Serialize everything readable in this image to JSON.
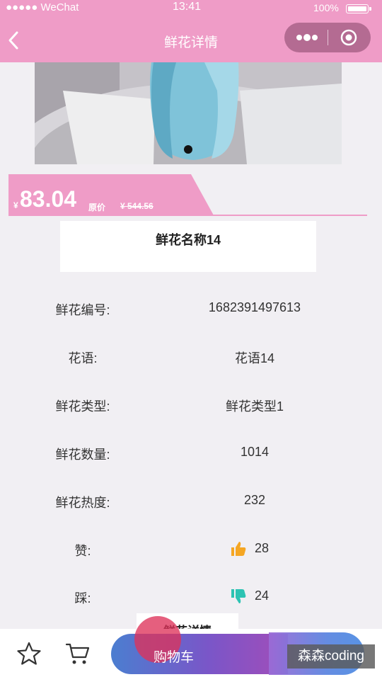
{
  "status_bar": {
    "carrier": "●●●●● WeChat",
    "time": "13:41",
    "battery": "100%"
  },
  "nav": {
    "title": "鲜花详情",
    "back_icon": "chevron-left-icon",
    "more_icon": "more-dots-icon",
    "close_icon": "target-circle-icon"
  },
  "price": {
    "currency": "¥",
    "current": "83.04",
    "original_label": "原价",
    "original_value": "¥ 544.56"
  },
  "flower": {
    "name": "鲜花名称14"
  },
  "details": [
    {
      "label": "鲜花编号:",
      "value": "1682391497613"
    },
    {
      "label": "花语:",
      "value": "花语14"
    },
    {
      "label": "鲜花类型:",
      "value": "鲜花类型1"
    },
    {
      "label": "鲜花数量:",
      "value": "1014"
    },
    {
      "label": "鲜花热度:",
      "value": "232"
    }
  ],
  "votes": {
    "like_label": "赞:",
    "like_count": "28",
    "dislike_label": "踩:",
    "dislike_count": "24"
  },
  "details_section": {
    "title": "鲜花详情"
  },
  "bottom": {
    "favorite_icon": "star-icon",
    "cart_icon": "cart-icon",
    "add_cart_label": "购物车"
  },
  "watermark": "森森coding",
  "colors": {
    "brand_pink": "#ef9cc7",
    "capsule": "#b46b92",
    "like": "#f5a623",
    "dislike": "#2dc3b3"
  }
}
